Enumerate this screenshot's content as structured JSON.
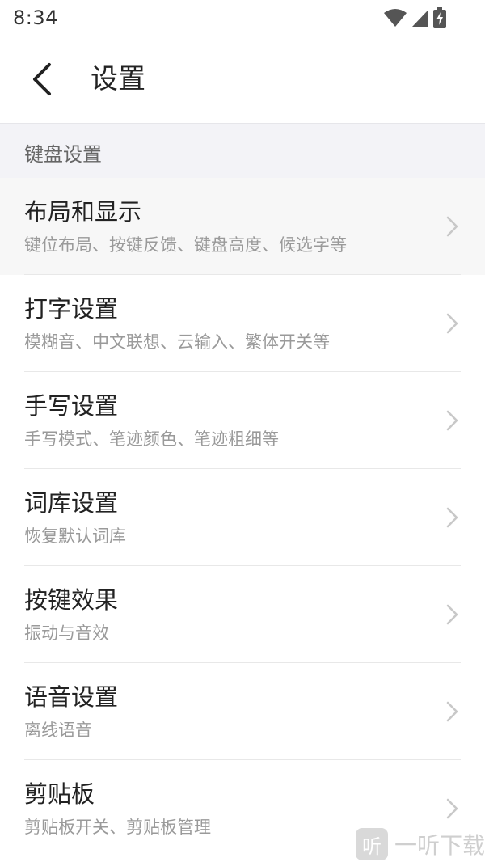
{
  "status_bar": {
    "time": "8:34",
    "icons": [
      "wifi-icon",
      "signal-icon",
      "battery-charging-icon"
    ]
  },
  "header": {
    "back_icon": "chevron-left-icon",
    "title": "设置"
  },
  "section": {
    "title": "键盘设置"
  },
  "items": [
    {
      "title": "布局和显示",
      "subtitle": "键位布局、按键反馈、键盘高度、候选字等"
    },
    {
      "title": "打字设置",
      "subtitle": "模糊音、中文联想、云输入、繁体开关等"
    },
    {
      "title": "手写设置",
      "subtitle": "手写模式、笔迹颜色、笔迹粗细等"
    },
    {
      "title": "词库设置",
      "subtitle": "恢复默认词库"
    },
    {
      "title": "按键效果",
      "subtitle": "振动与音效"
    },
    {
      "title": "语音设置",
      "subtitle": "离线语音"
    },
    {
      "title": "剪贴板",
      "subtitle": "剪贴板开关、剪贴板管理"
    }
  ],
  "watermark": {
    "logo_glyph": "听",
    "text": "一听下载"
  },
  "colors": {
    "section_bg": "#f3f3f7",
    "pressed_bg": "#f7f7f7",
    "subtitle": "#9a9a9a",
    "chevron": "#c8c8c8"
  }
}
